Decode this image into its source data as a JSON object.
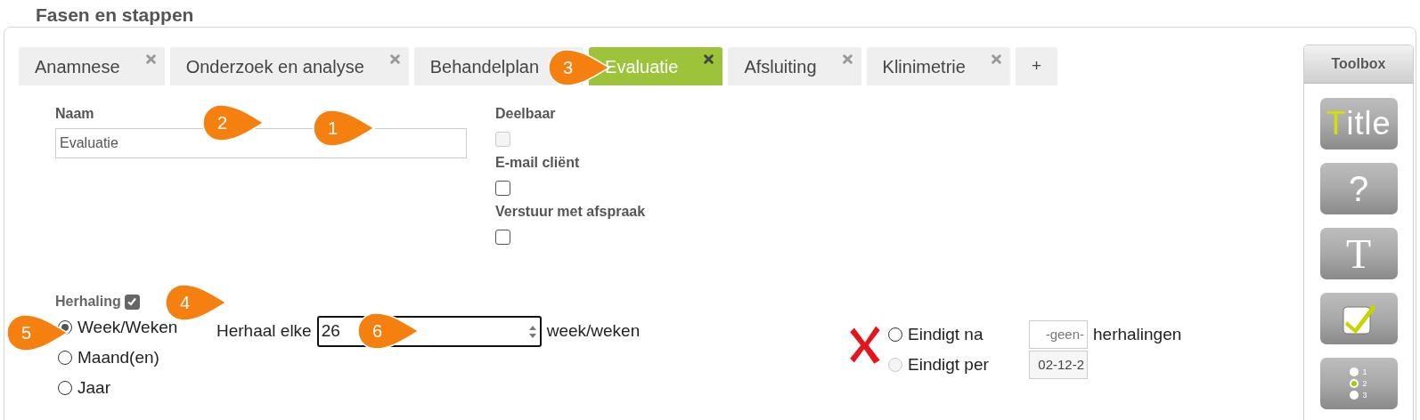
{
  "page_title": "Fasen en stappen",
  "tabs": [
    {
      "label": "Anamnese",
      "selected": false,
      "closable": true
    },
    {
      "label": "Onderzoek en analyse",
      "selected": false,
      "closable": true
    },
    {
      "label": "Behandelplan",
      "selected": false,
      "closable": false
    },
    {
      "label": "Evaluatie",
      "selected": true,
      "closable": true
    },
    {
      "label": "Afsluiting",
      "selected": false,
      "closable": true
    },
    {
      "label": "Klinimetrie",
      "selected": false,
      "closable": true
    }
  ],
  "add_tab": "+",
  "name_field": {
    "label": "Naam",
    "value": "Evaluatie"
  },
  "options": [
    {
      "label": "Deelbaar",
      "checked": false,
      "disabled": true
    },
    {
      "label": "E-mail cliënt",
      "checked": false,
      "disabled": false
    },
    {
      "label": "Verstuur met afspraak",
      "checked": false,
      "disabled": false
    }
  ],
  "repeat": {
    "label": "Herhaling",
    "checked": true,
    "periods": [
      {
        "label": "Week/Weken",
        "selected": true
      },
      {
        "label": "Maand(en)",
        "selected": false
      },
      {
        "label": "Jaar",
        "selected": false
      }
    ],
    "interval_label": "Herhaal elke",
    "interval_value": "26",
    "interval_unit": "week/weken",
    "end_options": [
      {
        "label": "Eindigt na",
        "selected": false,
        "disabled": false,
        "field": "-geen-",
        "unit": "herhalingen"
      },
      {
        "label": "Eindigt per",
        "selected": false,
        "disabled": true,
        "field": "02-12-2"
      }
    ]
  },
  "toolbox": {
    "title": "Toolbox",
    "items": [
      {
        "kind": "title",
        "label": "Title"
      },
      {
        "kind": "help",
        "label": "?"
      },
      {
        "kind": "text",
        "label": "T"
      },
      {
        "kind": "checkbox"
      },
      {
        "kind": "radio",
        "options": [
          {
            "label": "1",
            "selected": false
          },
          {
            "label": "2",
            "selected": true
          },
          {
            "label": "3",
            "selected": false
          }
        ]
      }
    ]
  },
  "callouts": [
    "1",
    "2",
    "3",
    "4",
    "5",
    "6"
  ]
}
